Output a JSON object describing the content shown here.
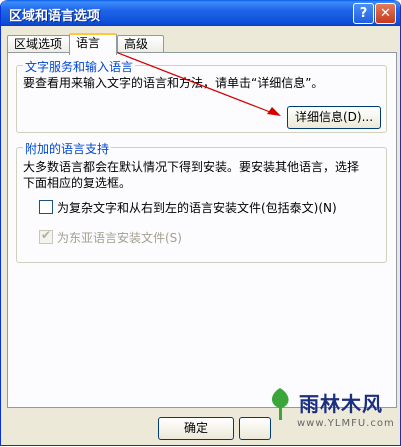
{
  "window": {
    "title": "区域和语言选项"
  },
  "titlebar": {
    "help_label": "?",
    "close_label": "✕"
  },
  "tabs": [
    {
      "label": "区域选项"
    },
    {
      "label": "语言"
    },
    {
      "label": "高级"
    }
  ],
  "text_services": {
    "title": "文字服务和输入语言",
    "description": "要查看用来输入文字的语言和方法，请单击“详细信息”。",
    "details_button": "详细信息(D)..."
  },
  "supplemental": {
    "title": "附加的语言支持",
    "description_line1": "大多数语言都会在默认情况下得到安装。要安装其他语言，选择",
    "description_line2": "下面相应的复选框。",
    "complex_script": {
      "label": "为复杂文字和从右到左的语言安装文件(包括泰文)(N)",
      "checked": false
    },
    "east_asian": {
      "label": "为东亚语言安装文件(S)",
      "checked": true,
      "disabled": true
    }
  },
  "bottom": {
    "ok_label": "确定"
  },
  "annotation": {
    "color": "#d40000"
  },
  "watermark": {
    "main": "雨林木风",
    "sub": "www.YLMFU.com"
  }
}
